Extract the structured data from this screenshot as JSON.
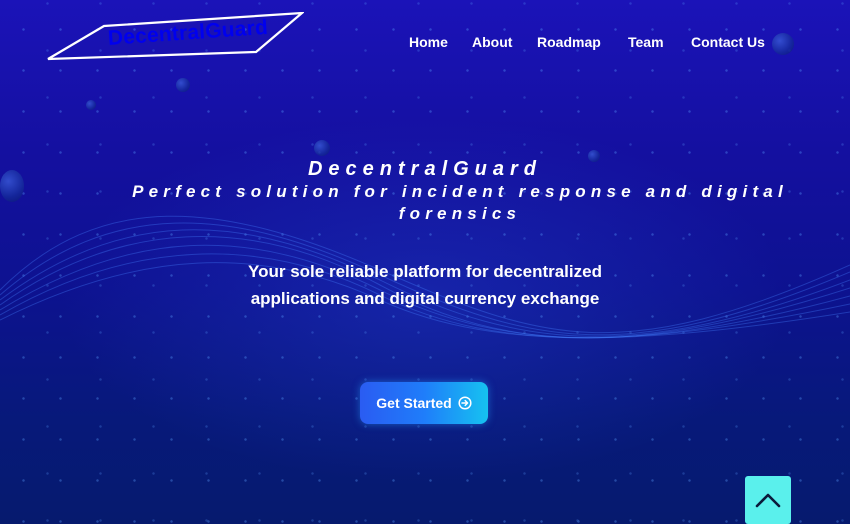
{
  "brand": {
    "name": "DecentralGuard"
  },
  "nav": {
    "items": [
      {
        "label": "Home"
      },
      {
        "label": "About"
      },
      {
        "label": "Roadmap"
      },
      {
        "label": "Team"
      },
      {
        "label": "Contact Us"
      }
    ]
  },
  "hero": {
    "title": "DecentralGuard",
    "tagline": "Perfect solution for incident response and digital forensics",
    "description": "Your sole reliable platform for decentralized applications and digital currency exchange",
    "cta_label": "Get Started",
    "cta_icon": "arrow-right-circle-icon"
  },
  "scroll_top": {
    "icon": "chevron-up-icon"
  },
  "colors": {
    "background_top": "#1b13b8",
    "background_bottom": "#061a6e",
    "cta_start": "#2a5cf2",
    "cta_end": "#16c2f0",
    "scroll_top_bg": "#5af0ec"
  }
}
